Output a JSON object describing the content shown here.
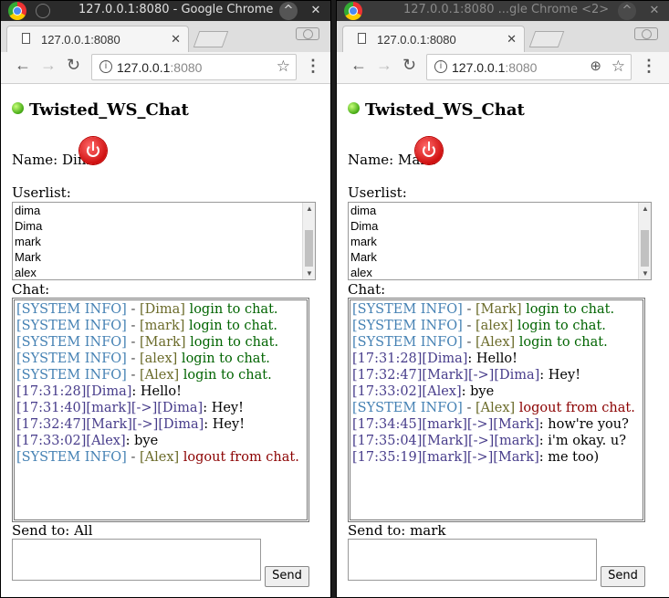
{
  "windows": [
    {
      "window_title": "127.0.0.1:8080 - Google Chrome",
      "tab_title": "127.0.0.1:8080",
      "url_host": "127.0.0.1",
      "url_port": ":8080",
      "app_title": "Twisted_WS_Chat",
      "name_label": "Name: Dima",
      "userlist_label": "Userlist:",
      "users": [
        "dima",
        "Dima",
        "mark",
        "Mark",
        "alex"
      ],
      "chat_label": "Chat:",
      "messages": [
        {
          "kind": "system",
          "prefix": "[SYSTEM INFO]",
          "dash": " - ",
          "who": "[Dima]",
          "text": " login to chat."
        },
        {
          "kind": "system",
          "prefix": "[SYSTEM INFO]",
          "dash": " - ",
          "who": "[mark]",
          "text": " login to chat."
        },
        {
          "kind": "system",
          "prefix": "[SYSTEM INFO]",
          "dash": " - ",
          "who": "[Mark]",
          "text": " login to chat."
        },
        {
          "kind": "system",
          "prefix": "[SYSTEM INFO]",
          "dash": " - ",
          "who": "[alex]",
          "text": " login to chat."
        },
        {
          "kind": "system",
          "prefix": "[SYSTEM INFO]",
          "dash": " - ",
          "who": "[Alex]",
          "text": " login to chat."
        },
        {
          "kind": "msg",
          "head": "[17:31:28][Dima]",
          "text": ": Hello!"
        },
        {
          "kind": "msg",
          "head": "[17:31:40][mark][->][Dima]",
          "text": ": Hey!"
        },
        {
          "kind": "msg",
          "head": "[17:32:47][Mark][->][Dima]",
          "text": ": Hey!"
        },
        {
          "kind": "msg",
          "head": "[17:33:02][Alex]",
          "text": ": bye"
        },
        {
          "kind": "logout",
          "prefix": "[SYSTEM INFO]",
          "dash": " - ",
          "who": "[Alex]",
          "text": " logout from chat."
        }
      ],
      "send_to_label": "Send to: All",
      "send_button": "Send"
    },
    {
      "window_title": "127.0.0.1:8080 ...gle Chrome <2>",
      "tab_title": "127.0.0.1:8080",
      "url_host": "127.0.0.1",
      "url_port": ":8080",
      "app_title": "Twisted_WS_Chat",
      "name_label": "Name: Mark",
      "userlist_label": "Userlist:",
      "users": [
        "dima",
        "Dima",
        "mark",
        "Mark",
        "alex"
      ],
      "chat_label": "Chat:",
      "messages": [
        {
          "kind": "system",
          "prefix": "[SYSTEM INFO]",
          "dash": " - ",
          "who": "[Mark]",
          "text": " login to chat."
        },
        {
          "kind": "system",
          "prefix": "[SYSTEM INFO]",
          "dash": " - ",
          "who": "[alex]",
          "text": " login to chat."
        },
        {
          "kind": "system",
          "prefix": "[SYSTEM INFO]",
          "dash": " - ",
          "who": "[Alex]",
          "text": " login to chat."
        },
        {
          "kind": "msg",
          "head": "[17:31:28][Dima]",
          "text": ": Hello!"
        },
        {
          "kind": "msg",
          "head": "[17:32:47][Mark][->][Dima]",
          "text": ": Hey!"
        },
        {
          "kind": "msg",
          "head": "[17:33:02][Alex]",
          "text": ": bye"
        },
        {
          "kind": "logout",
          "prefix": "[SYSTEM INFO]",
          "dash": " - ",
          "who": "[Alex]",
          "text": " logout from chat."
        },
        {
          "kind": "msg",
          "head": "[17:34:45][mark][->][Mark]",
          "text": ": how're you?"
        },
        {
          "kind": "msg",
          "head": "[17:35:04][Mark][->][mark]",
          "text": ": i'm okay. u?"
        },
        {
          "kind": "msg",
          "head": "[17:35:19][mark][->][Mark]",
          "text": ": me too)"
        }
      ],
      "send_to_label": "Send to: mark",
      "send_button": "Send"
    }
  ]
}
